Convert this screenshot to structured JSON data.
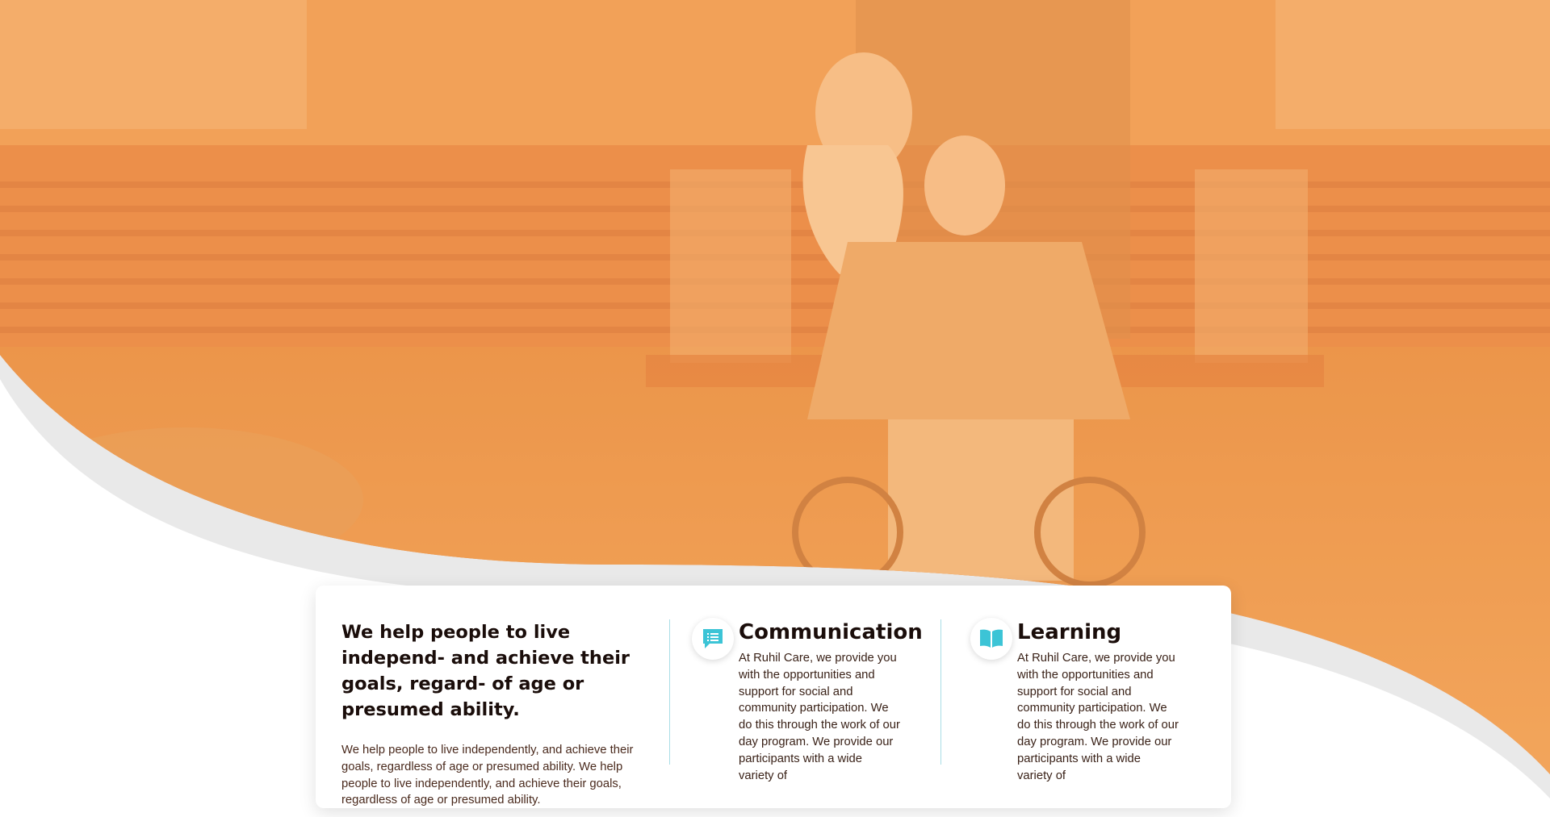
{
  "hero": {
    "image": "photo of a smiling young woman pushing an older man in a wheelchair in front of a brick house, with an orange overlay",
    "overlay_color": "#f6a24a"
  },
  "intro": {
    "heading": "We help people to live independ- and achieve their goals, regard- of age or presumed ability.",
    "text": "We help people to live independently, and achieve their goals, regardless of age or presumed ability. We help people to live independently, and achieve their goals, regardless of age or presumed ability."
  },
  "features": [
    {
      "icon": "chat-list-icon",
      "title": "Communication",
      "text": "At Ruhil Care, we provide you with the opportunities and support for social and community participation. We do this through the work of our day program. We provide our participants with a wide variety of"
    },
    {
      "icon": "open-book-icon",
      "title": "Learning",
      "text": "At Ruhil Care, we provide you with the opportunities and support for social and community participation. We do this through the work of our day program. We provide our participants with a wide variety of"
    }
  ],
  "colors": {
    "accent_teal": "#3cc4d6",
    "heading": "#1a0d0a",
    "divider": "#a9dde6"
  }
}
